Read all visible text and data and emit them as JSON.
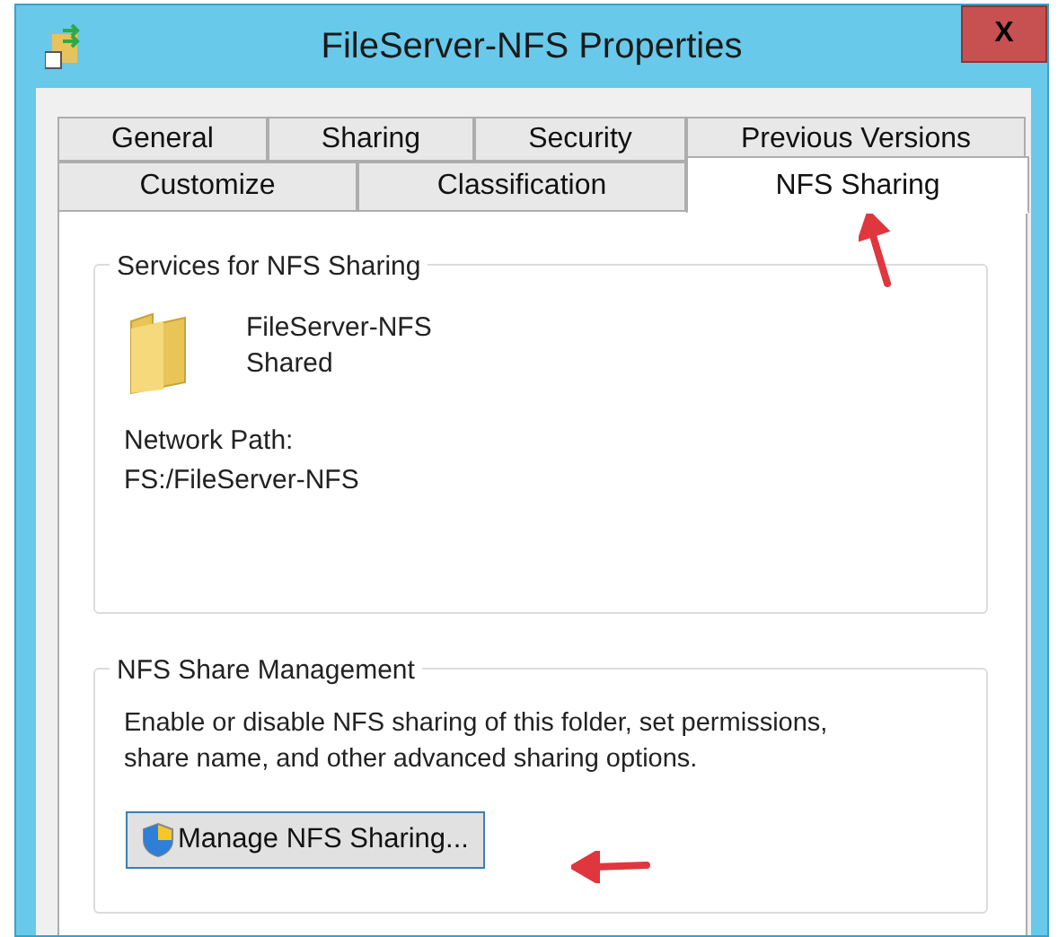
{
  "window": {
    "title": "FileServer-NFS Properties",
    "close_label": "X"
  },
  "tab_rows": [
    [
      {
        "label": "General",
        "selected": false
      },
      {
        "label": "Sharing",
        "selected": false
      },
      {
        "label": "Security",
        "selected": false
      },
      {
        "label": "Previous Versions",
        "selected": false
      }
    ],
    [
      {
        "label": "Customize",
        "selected": false
      },
      {
        "label": "Classification",
        "selected": false
      },
      {
        "label": "NFS Sharing",
        "selected": true
      }
    ]
  ],
  "services_group": {
    "title": "Services for NFS Sharing",
    "folder_name": "FileServer-NFS",
    "folder_status": "Shared",
    "network_path_label": "Network Path:",
    "network_path": "FS:/FileServer-NFS"
  },
  "management_group": {
    "title": "NFS Share Management",
    "description": "Enable or disable NFS sharing of this folder, set permissions, share name, and other advanced sharing options.",
    "button": "Manage NFS Sharing..."
  }
}
